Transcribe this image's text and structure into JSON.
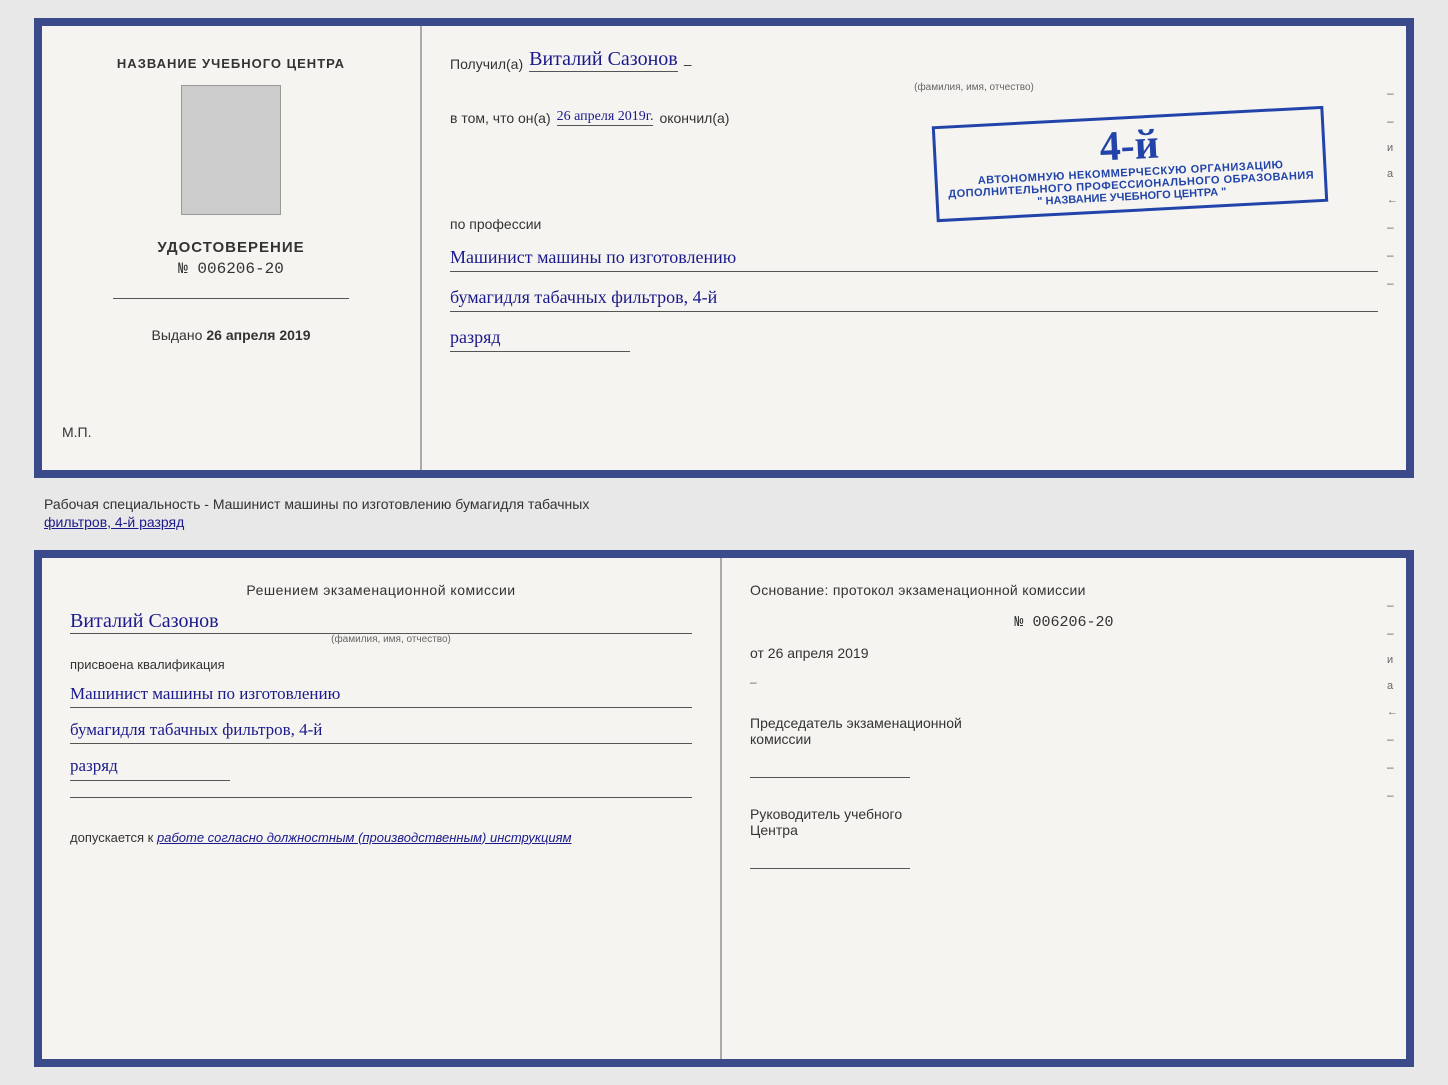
{
  "top_cert": {
    "left": {
      "org_name_label": "НАЗВАНИЕ УЧЕБНОГО ЦЕНТРА",
      "udostoverenie_label": "УДОСТОВЕРЕНИЕ",
      "number": "№ 006206-20",
      "vydano_label": "Выдано",
      "vydano_date": "26 апреля 2019",
      "mp_label": "М.П."
    },
    "right": {
      "poluchil_prefix": "Получил(а)",
      "recipient_name": "Виталий Сазонов",
      "fio_label": "(фамилия, имя, отчество)",
      "dash1": "–",
      "vtom_prefix": "в том, что он(а)",
      "vtom_date": "26 апреля 2019г.",
      "okonchil": "окончил(а)",
      "stamp_number": "4-й",
      "stamp_line1": "АВТОНОМНУЮ НЕКОММЕРЧЕСКУЮ ОРГАНИЗАЦИЮ",
      "stamp_line2": "ДОПОЛНИТЕЛЬНОГО ПРОФЕССИОНАЛЬНОГО ОБРАЗОВАНИЯ",
      "stamp_quotes": "\" НАЗВАНИЕ УЧЕБНОГО ЦЕНТРА \"",
      "po_professii": "по профессии",
      "profession_line1": "Машинист машины по изготовлению",
      "profession_line2": "бумагидля табачных фильтров, 4-й",
      "profession_line3": "разряд"
    }
  },
  "middle_label": {
    "static_text": "Рабочая специальность - Машинист машины по изготовлению бумагидля табачных",
    "underline_text": "фильтров, 4-й разряд"
  },
  "bottom_cert": {
    "left": {
      "resheniyem": "Решением  экзаменационной  комиссии",
      "name": "Виталий Сазонов",
      "fio_label": "(фамилия, имя, отчество)",
      "prisvoena": "присвоена квалификация",
      "profession_line1": "Машинист машины по изготовлению",
      "profession_line2": "бумагидля табачных фильтров, 4-й",
      "profession_line3": "разряд",
      "dopuskaetsya_prefix": "допускается к",
      "dopuskaetsya_text": "работе согласно должностным (производственным) инструкциям"
    },
    "right": {
      "osnovanie": "Основание: протокол экзаменационной  комиссии",
      "number": "№  006206-20",
      "ot_prefix": "от",
      "ot_date": "26 апреля 2019",
      "predsedatel_line1": "Председатель экзаменационной",
      "predsedatel_line2": "комиссии",
      "rukovoditel_line1": "Руководитель учебного",
      "rukovoditel_line2": "Центра",
      "side_chars": [
        "и",
        "а",
        "←",
        "–",
        "–",
        "–",
        "–"
      ]
    }
  }
}
